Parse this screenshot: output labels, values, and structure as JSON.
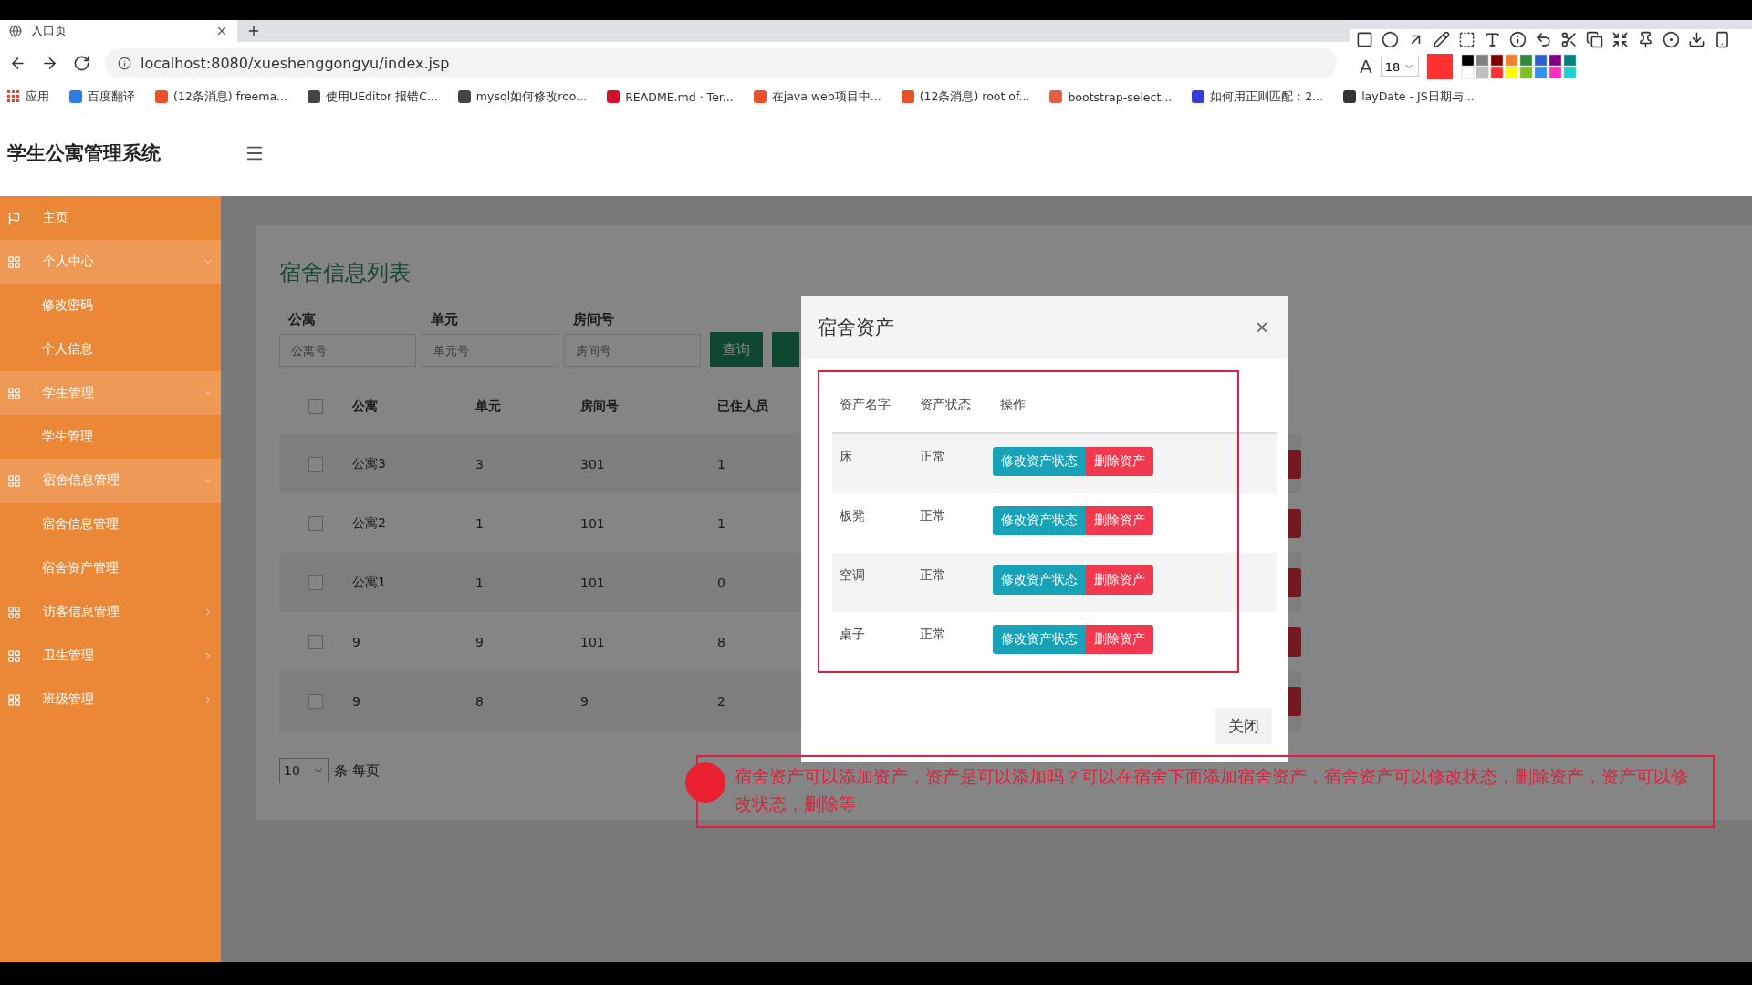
{
  "browser": {
    "tab": {
      "title": "入口页",
      "selected": true
    },
    "url": "localhost:8080/xueshenggongyu/index.jsp",
    "bookmarks": [
      {
        "label": "应用",
        "color": "#e84335"
      },
      {
        "label": "百度翻译",
        "color": "#2f7de1"
      },
      {
        "label": "(12条消息) freema...",
        "color": "#e8512c"
      },
      {
        "label": "使用UEditor 报错C...",
        "color": "#444444"
      },
      {
        "label": "mysql如何修改roo...",
        "color": "#444444"
      },
      {
        "label": "README.md · Ter...",
        "color": "#d0122b"
      },
      {
        "label": "在java web项目中...",
        "color": "#e8512c"
      },
      {
        "label": "(12条消息) root of...",
        "color": "#e8512c"
      },
      {
        "label": "bootstrap-select...",
        "color": "#e06040"
      },
      {
        "label": "如何用正则匹配：2...",
        "color": "#3a3ad8"
      },
      {
        "label": "layDate - JS日期与...",
        "color": "#333333"
      }
    ]
  },
  "capture_toolbar": {
    "font_size_label": "A",
    "font_size": "18",
    "palette": [
      {
        "color": "#000000"
      },
      {
        "color": "#808080"
      },
      {
        "color": "#800000"
      },
      {
        "color": "#f08030"
      },
      {
        "color": "#2e8b3a"
      },
      {
        "color": "#3060d0"
      },
      {
        "color": "#800080"
      },
      {
        "color": "#008080"
      },
      {
        "color": "#ffffff"
      },
      {
        "color": "#c0c0c0"
      },
      {
        "color": "#ff3030"
      },
      {
        "color": "#ffff00"
      },
      {
        "color": "#80c020"
      },
      {
        "color": "#3090f0"
      },
      {
        "color": "#ff30c0"
      },
      {
        "color": "#20d0d0"
      }
    ]
  },
  "app": {
    "title": "学生公寓管理系统"
  },
  "sidebar": {
    "items": [
      {
        "kind": "link",
        "label": "主页"
      },
      {
        "kind": "group",
        "label": "个人中心",
        "expanded": true,
        "children": [
          {
            "label": "修改密码"
          },
          {
            "label": "个人信息"
          }
        ]
      },
      {
        "kind": "group",
        "label": "学生管理",
        "expanded": true,
        "children": [
          {
            "label": "学生管理"
          }
        ]
      },
      {
        "kind": "group",
        "label": "宿舍信息管理",
        "expanded": true,
        "children": [
          {
            "label": "宿舍信息管理"
          },
          {
            "label": "宿舍资产管理"
          }
        ]
      },
      {
        "kind": "group",
        "label": "访客信息管理",
        "expanded": false
      },
      {
        "kind": "group",
        "label": "卫生管理",
        "expanded": false
      },
      {
        "kind": "group",
        "label": "班级管理",
        "expanded": false
      }
    ]
  },
  "page": {
    "title": "宿舍信息列表",
    "filters": [
      {
        "label": "公寓",
        "placeholder": "公寓号"
      },
      {
        "label": "单元",
        "placeholder": "单元号"
      },
      {
        "label": "房间号",
        "placeholder": "房间号"
      }
    ],
    "search_button": "查询",
    "table": {
      "columns": [
        "公寓",
        "单元",
        "房间号",
        "已住人员"
      ],
      "all_checked": false,
      "rows": [
        {
          "checked": false,
          "cells": [
            "公寓3",
            "3",
            "301",
            "1"
          ]
        },
        {
          "checked": false,
          "cells": [
            "公寓2",
            "1",
            "101",
            "1"
          ]
        },
        {
          "checked": false,
          "cells": [
            "公寓1",
            "1",
            "101",
            "0"
          ]
        },
        {
          "checked": false,
          "cells": [
            "9",
            "9",
            "101",
            "8"
          ]
        },
        {
          "checked": false,
          "cells": [
            "9",
            "8",
            "9",
            "2"
          ]
        }
      ]
    },
    "page_size": "10",
    "page_size_label": "条 每页"
  },
  "modal": {
    "title": "宿舍资产",
    "close": "×",
    "columns": [
      "资产名字",
      "资产状态",
      "操作"
    ],
    "rows": [
      {
        "name": "床",
        "status": "正常",
        "actions": [
          "修改资产状态",
          "删除资产"
        ]
      },
      {
        "name": "板凳",
        "status": "正常",
        "actions": [
          "修改资产状态",
          "删除资产"
        ]
      },
      {
        "name": "空调",
        "status": "正常",
        "actions": [
          "修改资产状态",
          "删除资产"
        ]
      },
      {
        "name": "桌子",
        "status": "正常",
        "actions": [
          "修改资产状态",
          "删除资产"
        ]
      }
    ],
    "footer_button": "关闭"
  },
  "annotation": {
    "text": "宿舍资产可以添加资产，资产是可以添加吗？可以在宿舍下面添加宿舍资产，宿舍资产可以修改状态，删除资产，资产可以修改状态，删除等"
  }
}
